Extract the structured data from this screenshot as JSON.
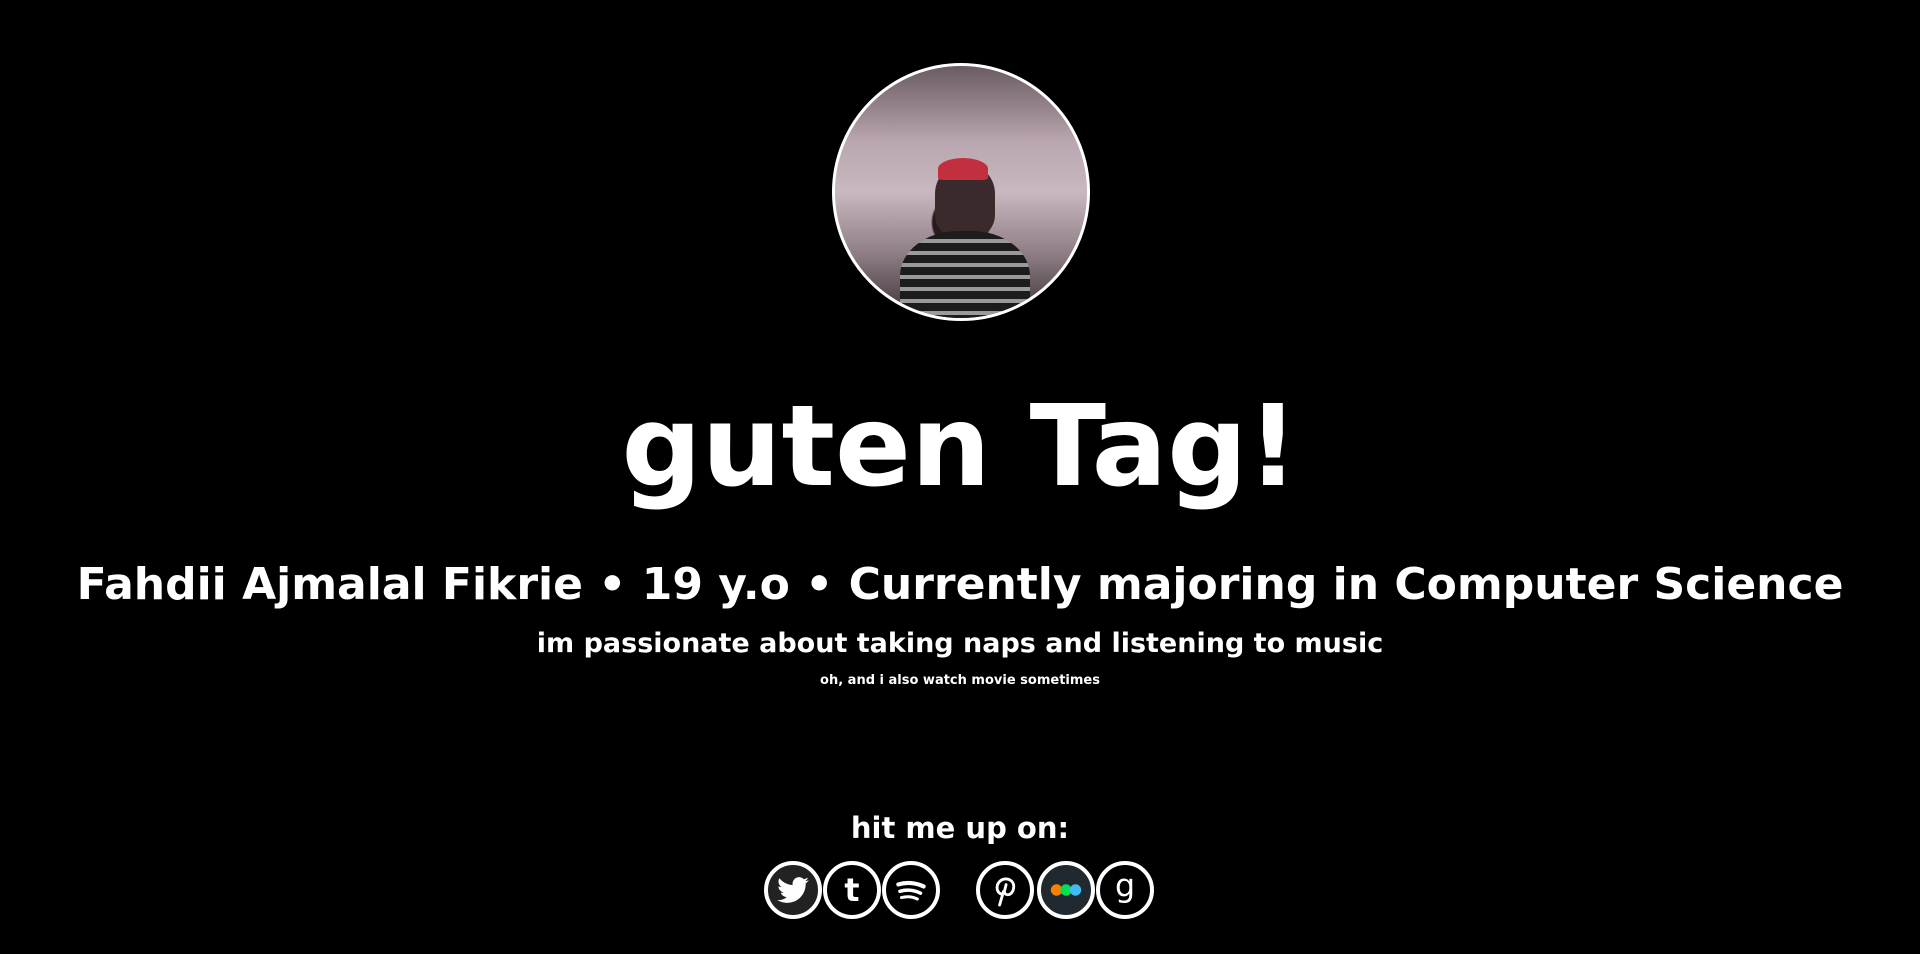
{
  "profile": {
    "greeting": "guten Tag!",
    "summary": "Fahdii Ajmalal Fikrie • 19 y.o • Currently majoring in Computer Science",
    "passion": "im passionate about taking naps and listening to music",
    "aside": "oh, and i also watch movie sometimes"
  },
  "contact": {
    "heading": "hit me up on:",
    "links": [
      {
        "name": "twitter",
        "icon": "twitter-icon"
      },
      {
        "name": "tumblr",
        "icon": "tumblr-icon"
      },
      {
        "name": "spotify",
        "icon": "spotify-icon"
      },
      {
        "name": "pinterest",
        "icon": "pinterest-icon"
      },
      {
        "name": "letterboxd",
        "icon": "letterboxd-icon",
        "colors": [
          "#ff8000",
          "#00e054",
          "#40bcf4"
        ]
      },
      {
        "name": "goodreads",
        "icon": "goodreads-icon"
      }
    ]
  }
}
